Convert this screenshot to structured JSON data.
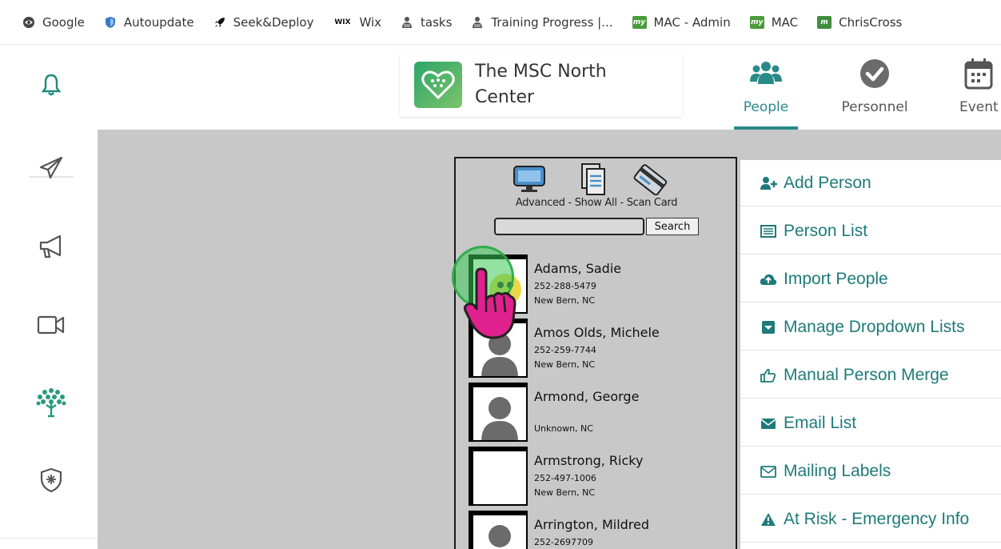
{
  "bookmarks": [
    {
      "label": "Google",
      "icon": "globe-icon"
    },
    {
      "label": "Autoupdate",
      "icon": "shield-icon"
    },
    {
      "label": "Seek&Deploy",
      "icon": "rocket-icon"
    },
    {
      "label": "Wix",
      "icon": "wix-icon"
    },
    {
      "label": "tasks",
      "icon": "person-icon"
    },
    {
      "label": "Training Progress |...",
      "icon": "person-icon"
    },
    {
      "label": "MAC - Admin",
      "icon": "my-icon"
    },
    {
      "label": "MAC",
      "icon": "my-icon"
    },
    {
      "label": "ChrisCross",
      "icon": "m-icon"
    }
  ],
  "header": {
    "org_name": "The MSC North Center",
    "tabs": [
      {
        "label": "People",
        "icon": "people-icon",
        "active": true
      },
      {
        "label": "Personnel",
        "icon": "check-circle-icon",
        "active": false
      },
      {
        "label": "Event",
        "icon": "calendar-icon",
        "active": false
      }
    ]
  },
  "rail": {
    "items": [
      "bell-icon",
      "paper-plane-icon",
      "megaphone-icon",
      "video-icon",
      "tree-icon",
      "badge-icon"
    ]
  },
  "search_panel": {
    "tools_caption": "Advanced - Show All - Scan Card",
    "search_placeholder": "",
    "search_button": "Search"
  },
  "people": [
    {
      "name": "Adams, Sadie",
      "phone": "252-288-5479",
      "location": "New Bern, NC",
      "photo": "custom"
    },
    {
      "name": "Amos Olds, Michele",
      "phone": "252-259-7744",
      "location": "New Bern, NC",
      "photo": "silhouette"
    },
    {
      "name": "Armond, George",
      "phone": "",
      "location": "Unknown, NC",
      "photo": "silhouette"
    },
    {
      "name": "Armstrong, Ricky",
      "phone": "252-497-1006",
      "location": "New Bern, NC",
      "photo": "blank"
    },
    {
      "name": "Arrington, Mildred",
      "phone": "252-2697709",
      "location": "",
      "photo": "silhouette"
    }
  ],
  "menu": [
    {
      "label": "Add Person",
      "icon": "user-plus-icon"
    },
    {
      "label": "Person List",
      "icon": "list-icon"
    },
    {
      "label": "Import People",
      "icon": "cloud-upload-icon"
    },
    {
      "label": "Manage Dropdown Lists",
      "icon": "dropdown-icon"
    },
    {
      "label": "Manual Person Merge",
      "icon": "thumbs-up-icon"
    },
    {
      "label": "Email List",
      "icon": "envelope-icon"
    },
    {
      "label": "Mailing Labels",
      "icon": "envelope-outline-icon"
    },
    {
      "label": "At Risk - Emergency Info",
      "icon": "warning-icon"
    }
  ],
  "colors": {
    "accent": "#2a8a8a",
    "menu_text": "#1f7a7a",
    "content_bg": "#c8c8c8"
  }
}
